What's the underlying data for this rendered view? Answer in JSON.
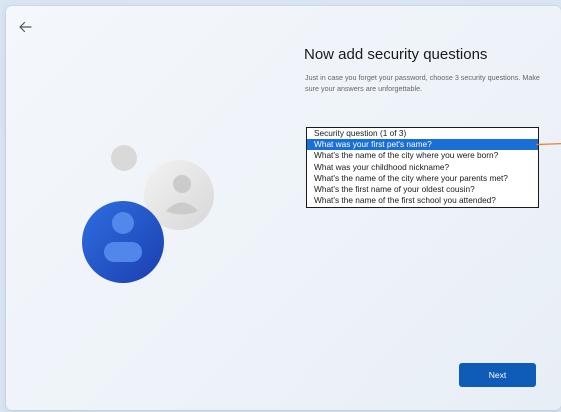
{
  "window": {
    "back_icon": "back-arrow-icon"
  },
  "content": {
    "title": "Now add security questions",
    "description": "Just in case you forget your password, choose 3 security questions. Make sure your answers are unforgettable."
  },
  "security_question_list": {
    "caption": "Security question (1 of 3)",
    "options": [
      "What was your first pet's name?",
      "What's the name of the city where you were born?",
      "What was your childhood nickname?",
      "What's the name of the city where your parents met?",
      "What's the first name of your oldest cousin?",
      "What's the name of the first school you attended?"
    ],
    "selected_option": "What was your first pet's name?"
  },
  "footer": {
    "next_label": "Next"
  },
  "colors": {
    "accent": "#0f5cb8",
    "selection": "#1a6fd6",
    "pointer": "#e8772e"
  },
  "illustration": {
    "icons": [
      "user-avatar-icon",
      "secondary-user-avatar-icon"
    ]
  }
}
